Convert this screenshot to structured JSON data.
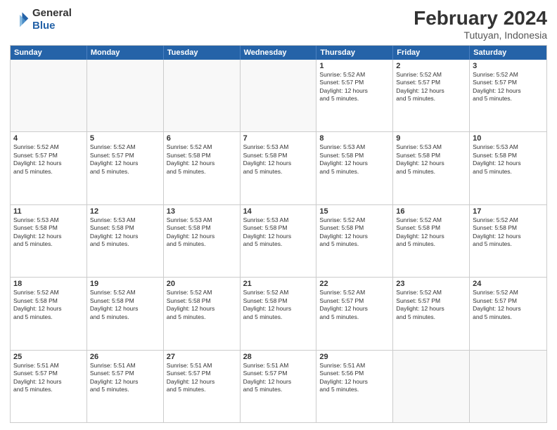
{
  "logo": {
    "line1": "General",
    "line2": "Blue"
  },
  "title": "February 2024",
  "subtitle": "Tutuyan, Indonesia",
  "days_header": [
    "Sunday",
    "Monday",
    "Tuesday",
    "Wednesday",
    "Thursday",
    "Friday",
    "Saturday"
  ],
  "weeks": [
    [
      {
        "day": "",
        "info": "",
        "empty": true
      },
      {
        "day": "",
        "info": "",
        "empty": true
      },
      {
        "day": "",
        "info": "",
        "empty": true
      },
      {
        "day": "",
        "info": "",
        "empty": true
      },
      {
        "day": "1",
        "info": "Sunrise: 5:52 AM\nSunset: 5:57 PM\nDaylight: 12 hours\nand 5 minutes."
      },
      {
        "day": "2",
        "info": "Sunrise: 5:52 AM\nSunset: 5:57 PM\nDaylight: 12 hours\nand 5 minutes."
      },
      {
        "day": "3",
        "info": "Sunrise: 5:52 AM\nSunset: 5:57 PM\nDaylight: 12 hours\nand 5 minutes."
      }
    ],
    [
      {
        "day": "4",
        "info": "Sunrise: 5:52 AM\nSunset: 5:57 PM\nDaylight: 12 hours\nand 5 minutes."
      },
      {
        "day": "5",
        "info": "Sunrise: 5:52 AM\nSunset: 5:57 PM\nDaylight: 12 hours\nand 5 minutes."
      },
      {
        "day": "6",
        "info": "Sunrise: 5:52 AM\nSunset: 5:58 PM\nDaylight: 12 hours\nand 5 minutes."
      },
      {
        "day": "7",
        "info": "Sunrise: 5:53 AM\nSunset: 5:58 PM\nDaylight: 12 hours\nand 5 minutes."
      },
      {
        "day": "8",
        "info": "Sunrise: 5:53 AM\nSunset: 5:58 PM\nDaylight: 12 hours\nand 5 minutes."
      },
      {
        "day": "9",
        "info": "Sunrise: 5:53 AM\nSunset: 5:58 PM\nDaylight: 12 hours\nand 5 minutes."
      },
      {
        "day": "10",
        "info": "Sunrise: 5:53 AM\nSunset: 5:58 PM\nDaylight: 12 hours\nand 5 minutes."
      }
    ],
    [
      {
        "day": "11",
        "info": "Sunrise: 5:53 AM\nSunset: 5:58 PM\nDaylight: 12 hours\nand 5 minutes."
      },
      {
        "day": "12",
        "info": "Sunrise: 5:53 AM\nSunset: 5:58 PM\nDaylight: 12 hours\nand 5 minutes."
      },
      {
        "day": "13",
        "info": "Sunrise: 5:53 AM\nSunset: 5:58 PM\nDaylight: 12 hours\nand 5 minutes."
      },
      {
        "day": "14",
        "info": "Sunrise: 5:53 AM\nSunset: 5:58 PM\nDaylight: 12 hours\nand 5 minutes."
      },
      {
        "day": "15",
        "info": "Sunrise: 5:52 AM\nSunset: 5:58 PM\nDaylight: 12 hours\nand 5 minutes."
      },
      {
        "day": "16",
        "info": "Sunrise: 5:52 AM\nSunset: 5:58 PM\nDaylight: 12 hours\nand 5 minutes."
      },
      {
        "day": "17",
        "info": "Sunrise: 5:52 AM\nSunset: 5:58 PM\nDaylight: 12 hours\nand 5 minutes."
      }
    ],
    [
      {
        "day": "18",
        "info": "Sunrise: 5:52 AM\nSunset: 5:58 PM\nDaylight: 12 hours\nand 5 minutes."
      },
      {
        "day": "19",
        "info": "Sunrise: 5:52 AM\nSunset: 5:58 PM\nDaylight: 12 hours\nand 5 minutes."
      },
      {
        "day": "20",
        "info": "Sunrise: 5:52 AM\nSunset: 5:58 PM\nDaylight: 12 hours\nand 5 minutes."
      },
      {
        "day": "21",
        "info": "Sunrise: 5:52 AM\nSunset: 5:58 PM\nDaylight: 12 hours\nand 5 minutes."
      },
      {
        "day": "22",
        "info": "Sunrise: 5:52 AM\nSunset: 5:57 PM\nDaylight: 12 hours\nand 5 minutes."
      },
      {
        "day": "23",
        "info": "Sunrise: 5:52 AM\nSunset: 5:57 PM\nDaylight: 12 hours\nand 5 minutes."
      },
      {
        "day": "24",
        "info": "Sunrise: 5:52 AM\nSunset: 5:57 PM\nDaylight: 12 hours\nand 5 minutes."
      }
    ],
    [
      {
        "day": "25",
        "info": "Sunrise: 5:51 AM\nSunset: 5:57 PM\nDaylight: 12 hours\nand 5 minutes."
      },
      {
        "day": "26",
        "info": "Sunrise: 5:51 AM\nSunset: 5:57 PM\nDaylight: 12 hours\nand 5 minutes."
      },
      {
        "day": "27",
        "info": "Sunrise: 5:51 AM\nSunset: 5:57 PM\nDaylight: 12 hours\nand 5 minutes."
      },
      {
        "day": "28",
        "info": "Sunrise: 5:51 AM\nSunset: 5:57 PM\nDaylight: 12 hours\nand 5 minutes."
      },
      {
        "day": "29",
        "info": "Sunrise: 5:51 AM\nSunset: 5:56 PM\nDaylight: 12 hours\nand 5 minutes."
      },
      {
        "day": "",
        "info": "",
        "empty": true
      },
      {
        "day": "",
        "info": "",
        "empty": true
      }
    ]
  ]
}
